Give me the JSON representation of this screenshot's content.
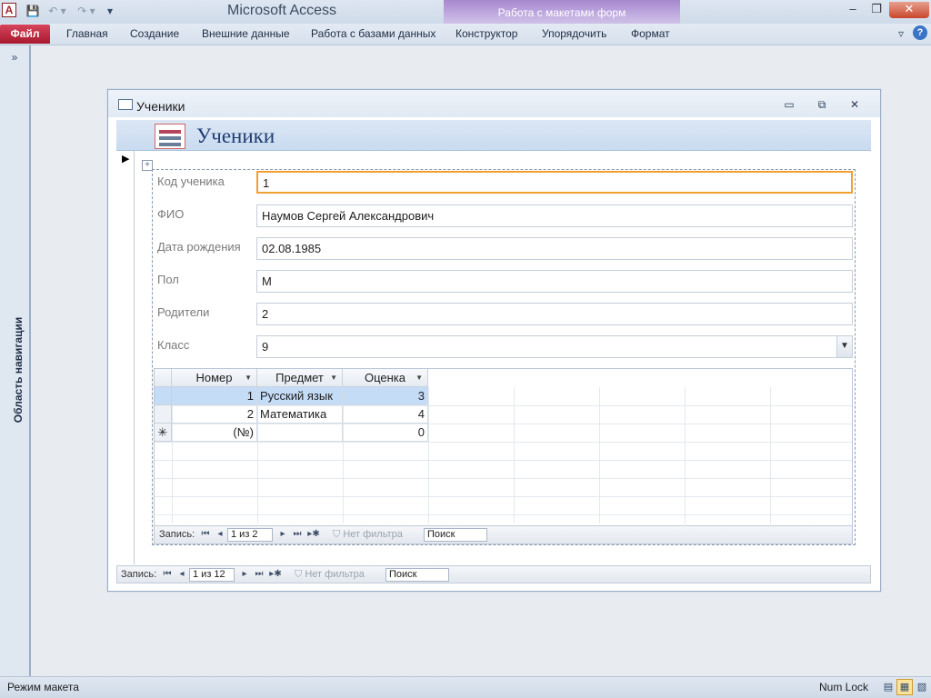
{
  "window": {
    "app_title": "Microsoft Access",
    "context_tab_group": "Работа с макетами форм",
    "app_icon_letter": "A"
  },
  "quick_access": {
    "save_icon": "💾",
    "undo_icon": "↶ ▾",
    "redo_icon": "↷ ▾",
    "customize_icon": "▾"
  },
  "window_controls": {
    "minimize": "–",
    "maximize": "❐",
    "close": "✕"
  },
  "ribbon": {
    "file_tab": "Файл",
    "tabs": [
      "Главная",
      "Создание",
      "Внешние данные",
      "Работа с базами данных",
      "Конструктор",
      "Упорядочить",
      "Формат"
    ],
    "help_chevron": "▿",
    "help_icon": "?"
  },
  "nav_pane": {
    "label": "Область навигации",
    "toggle": "»"
  },
  "form_window": {
    "title": "Ученики",
    "header_title": "Ученики",
    "controls": {
      "minimize": "▭",
      "maximize": "⧉",
      "close": "✕"
    }
  },
  "fields": [
    {
      "label": "Код ученика",
      "value": "1"
    },
    {
      "label": "ФИО",
      "value": "Наумов Сергей Александрович"
    },
    {
      "label": "Дата рождения",
      "value": "02.08.1985"
    },
    {
      "label": "Пол",
      "value": "М"
    },
    {
      "label": "Родители",
      "value": "2"
    },
    {
      "label": "Класс",
      "value": "9"
    }
  ],
  "subform": {
    "columns": [
      "Номер",
      "Предмет",
      "Оценка"
    ],
    "rows": [
      {
        "num": "1",
        "subject": "Русский язык",
        "grade": "3"
      },
      {
        "num": "2",
        "subject": "Математика",
        "grade": "4"
      },
      {
        "num": "(№)",
        "subject": "",
        "grade": "0"
      }
    ],
    "new_row_marker": "✳",
    "nav": {
      "label": "Запись:",
      "position": "1 из 2",
      "filter": "Нет фильтра",
      "search": "Поиск"
    }
  },
  "main_nav": {
    "label": "Запись:",
    "position": "1 из 12",
    "filter": "Нет фильтра",
    "search": "Поиск"
  },
  "nav_buttons": {
    "first": "⏮",
    "prev": "◂",
    "next": "▸",
    "last": "⏭",
    "new": "▸✱",
    "filter_icon": "⛉"
  },
  "status_bar": {
    "mode": "Режим макета",
    "numlock": "Num Lock",
    "views": [
      "▤",
      "▦",
      "▧"
    ]
  }
}
